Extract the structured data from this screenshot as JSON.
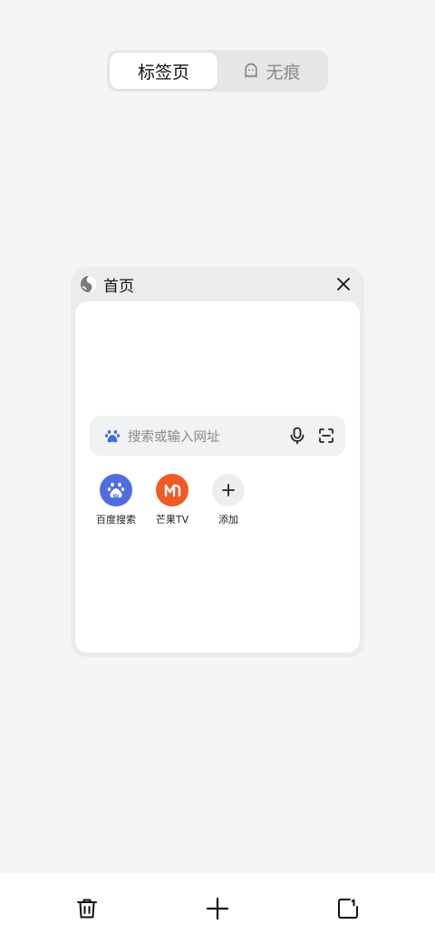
{
  "segment": {
    "tabs_label": "标签页",
    "incognito_label": "无痕",
    "active": "tabs"
  },
  "tab_card": {
    "title": "首页",
    "favicon": "globe-icon",
    "close_icon": "close-icon",
    "search_placeholder": "搜索或输入网址",
    "shortcuts": [
      {
        "label": "百度搜索",
        "icon": "baidu-paw-icon",
        "color": "#4e6ee0"
      },
      {
        "label": "芒果TV",
        "icon": "mango-tv-icon",
        "color": "#f05a24"
      },
      {
        "label": "添加",
        "icon": "plus-icon",
        "color": "#eeeeee"
      }
    ]
  },
  "toolbar": {
    "buttons": [
      "trash-icon",
      "plus-icon",
      "new-tab-window-icon"
    ]
  }
}
